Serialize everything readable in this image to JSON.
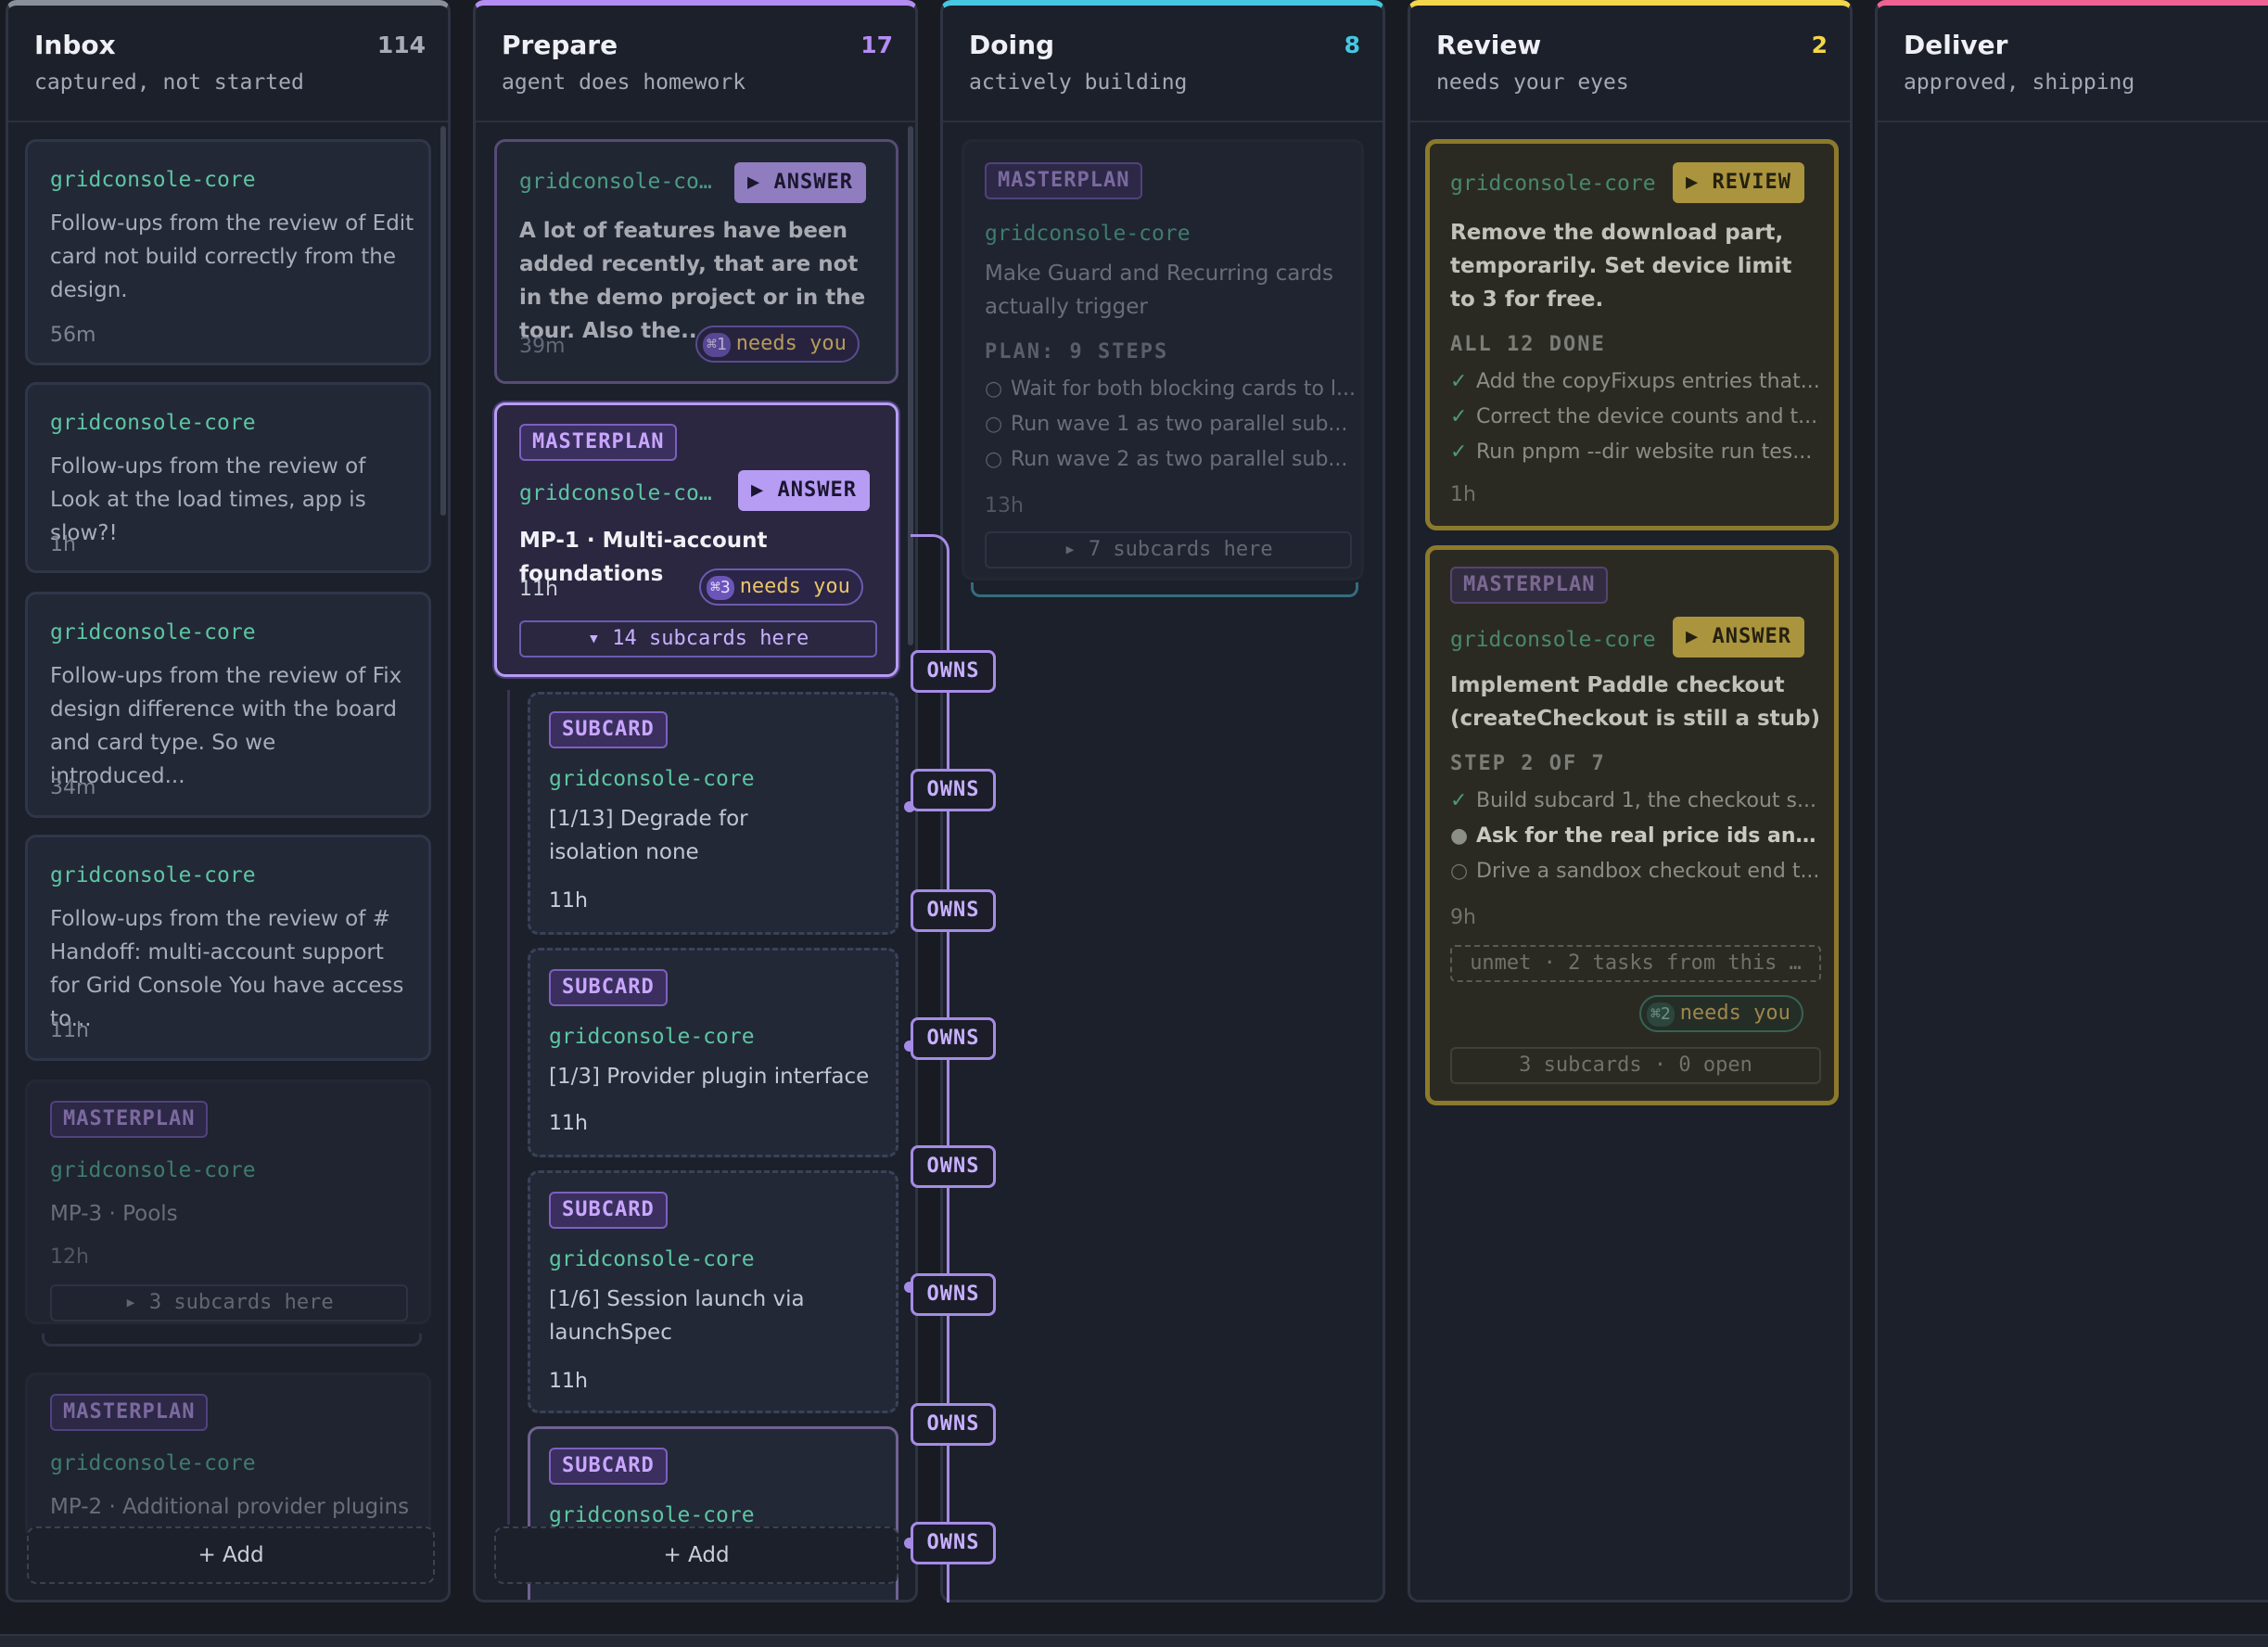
{
  "columns": [
    {
      "title": "Inbox",
      "count": "114",
      "subtitle": "captured, not started",
      "accent": "#8a8f9c"
    },
    {
      "title": "Prepare",
      "count": "17",
      "subtitle": "agent does homework",
      "accent": "#b58cf3"
    },
    {
      "title": "Doing",
      "count": "8",
      "subtitle": "actively building",
      "accent": "#46c7e2"
    },
    {
      "title": "Review",
      "count": "2",
      "subtitle": "needs your eyes",
      "accent": "#f2d64b"
    },
    {
      "title": "Deliver",
      "count": "",
      "subtitle": "approved, shipping",
      "accent": "#f06292"
    }
  ],
  "add_label": "+ Add",
  "inbox": {
    "cards": [
      {
        "repo": "gridconsole-core",
        "text": "Follow-ups from the review of Edit card not build correctly from the design.",
        "age": "56m"
      },
      {
        "repo": "gridconsole-core",
        "text": "Follow-ups from the review of Look at the load times, app is slow?!",
        "age": "1h"
      },
      {
        "repo": "gridconsole-core",
        "text": "Follow-ups from the review of Fix design difference with the board and card type. So we introduced...",
        "age": "34m"
      },
      {
        "repo": "gridconsole-core",
        "text": "Follow-ups from the review of # Handoff: multi-account support for Grid Console You have access to...",
        "age": "11h"
      }
    ],
    "mp3": {
      "tag": "MASTERPLAN",
      "repo": "gridconsole-core",
      "title": "MP-3 · Pools",
      "age": "12h",
      "subcards": "▸ 3 subcards here"
    },
    "mp2": {
      "tag": "MASTERPLAN",
      "repo": "gridconsole-core",
      "title": "MP-2 · Additional provider plugins"
    }
  },
  "prepare": {
    "card1": {
      "repo": "gridconsole-co…",
      "action": "▶ ANSWER",
      "text": "A lot of features have been added recently, that are not in the demo project or in the tour. Also the...",
      "age": "39m",
      "badge_key": "⌘1",
      "badge": "needs you"
    },
    "mp1": {
      "tag": "MASTERPLAN",
      "repo": "gridconsole-co…",
      "action": "▶ ANSWER",
      "title": "MP-1 · Multi-account foundations",
      "age": "11h",
      "badge_key": "⌘3",
      "badge": "needs you",
      "subcards": "▾ 14 subcards here"
    },
    "subcards": [
      {
        "tag": "SUBCARD",
        "repo": "gridconsole-core",
        "text": "[1/13] Degrade for isolation none",
        "age": "11h"
      },
      {
        "tag": "SUBCARD",
        "repo": "gridconsole-core",
        "text": "[1/3] Provider plugin interface",
        "age": "11h"
      },
      {
        "tag": "SUBCARD",
        "repo": "gridconsole-core",
        "text": "[1/6] Session launch via launchSpec",
        "age": "11h"
      },
      {
        "tag": "SUBCARD",
        "repo": "gridconsole-core",
        "text": "",
        "age": ""
      }
    ],
    "owns_label": "OWNS"
  },
  "doing": {
    "card": {
      "tag": "MASTERPLAN",
      "repo": "gridconsole-core",
      "text": "Make Guard and Recurring cards actually trigger",
      "plan": "PLAN: 9 STEPS",
      "steps": [
        "Wait for both blocking cards to l...",
        "Run wave 1 as two parallel sub...",
        "Run wave 2 as two parallel sub..."
      ],
      "age": "13h",
      "subcards": "▸ 7 subcards here"
    }
  },
  "review": {
    "card1": {
      "repo": "gridconsole-core",
      "action": "▶ REVIEW",
      "title": "Remove the download part, temporarily. Set device limit to 3 for free.",
      "status": "ALL 12 DONE",
      "steps": [
        "Add the copyFixups entries that...",
        "Correct the device counts and t...",
        "Run pnpm --dir website run tes..."
      ],
      "age": "1h"
    },
    "card2": {
      "tag": "MASTERPLAN",
      "repo": "gridconsole-core",
      "action": "▶ ANSWER",
      "title": "Implement Paddle checkout (createCheckout is still a stub)",
      "status": "STEP 2 OF 7",
      "steps": [
        "Build subcard 1, the checkout s...",
        "Ask for the real price ids and s...",
        "Drive a sandbox checkout end t..."
      ],
      "age": "9h",
      "unmet": "unmet · 2 tasks from this …",
      "badge_key": "⌘2",
      "badge": "needs you",
      "subcards": "3 subcards · 0 open"
    }
  },
  "colors": {
    "teal": "#5cc6a3",
    "purple": "#b58cf3",
    "gold": "#e0c24a",
    "bg": "#181b22"
  }
}
